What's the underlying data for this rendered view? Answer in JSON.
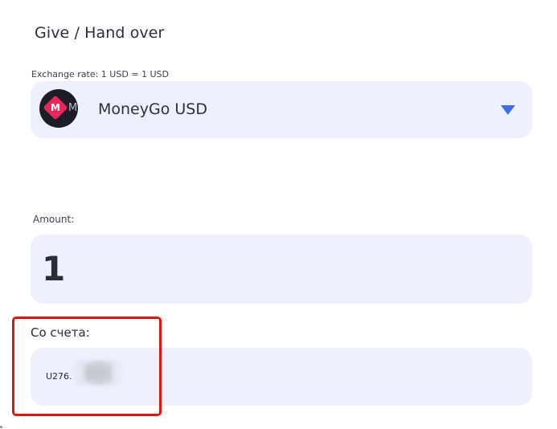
{
  "give": {
    "title": "Give / Hand over",
    "exchange_rate_text": "Exchange rate: 1 USD = 1 USD"
  },
  "currency_select": {
    "selected": "MoneyGo USD",
    "logo_letter": "M",
    "logo_icon": "moneygo-logo-icon",
    "arrow_icon": "triangle-down-icon",
    "arrow_color": "#3f6ee8"
  },
  "amount": {
    "label": "Amount:",
    "value": "1"
  },
  "account": {
    "label": "Со счета:",
    "value": "U276."
  },
  "colors": {
    "field_background": "#eef0fb",
    "highlight_border": "#e01414",
    "brand_pink": "#e8265a"
  }
}
